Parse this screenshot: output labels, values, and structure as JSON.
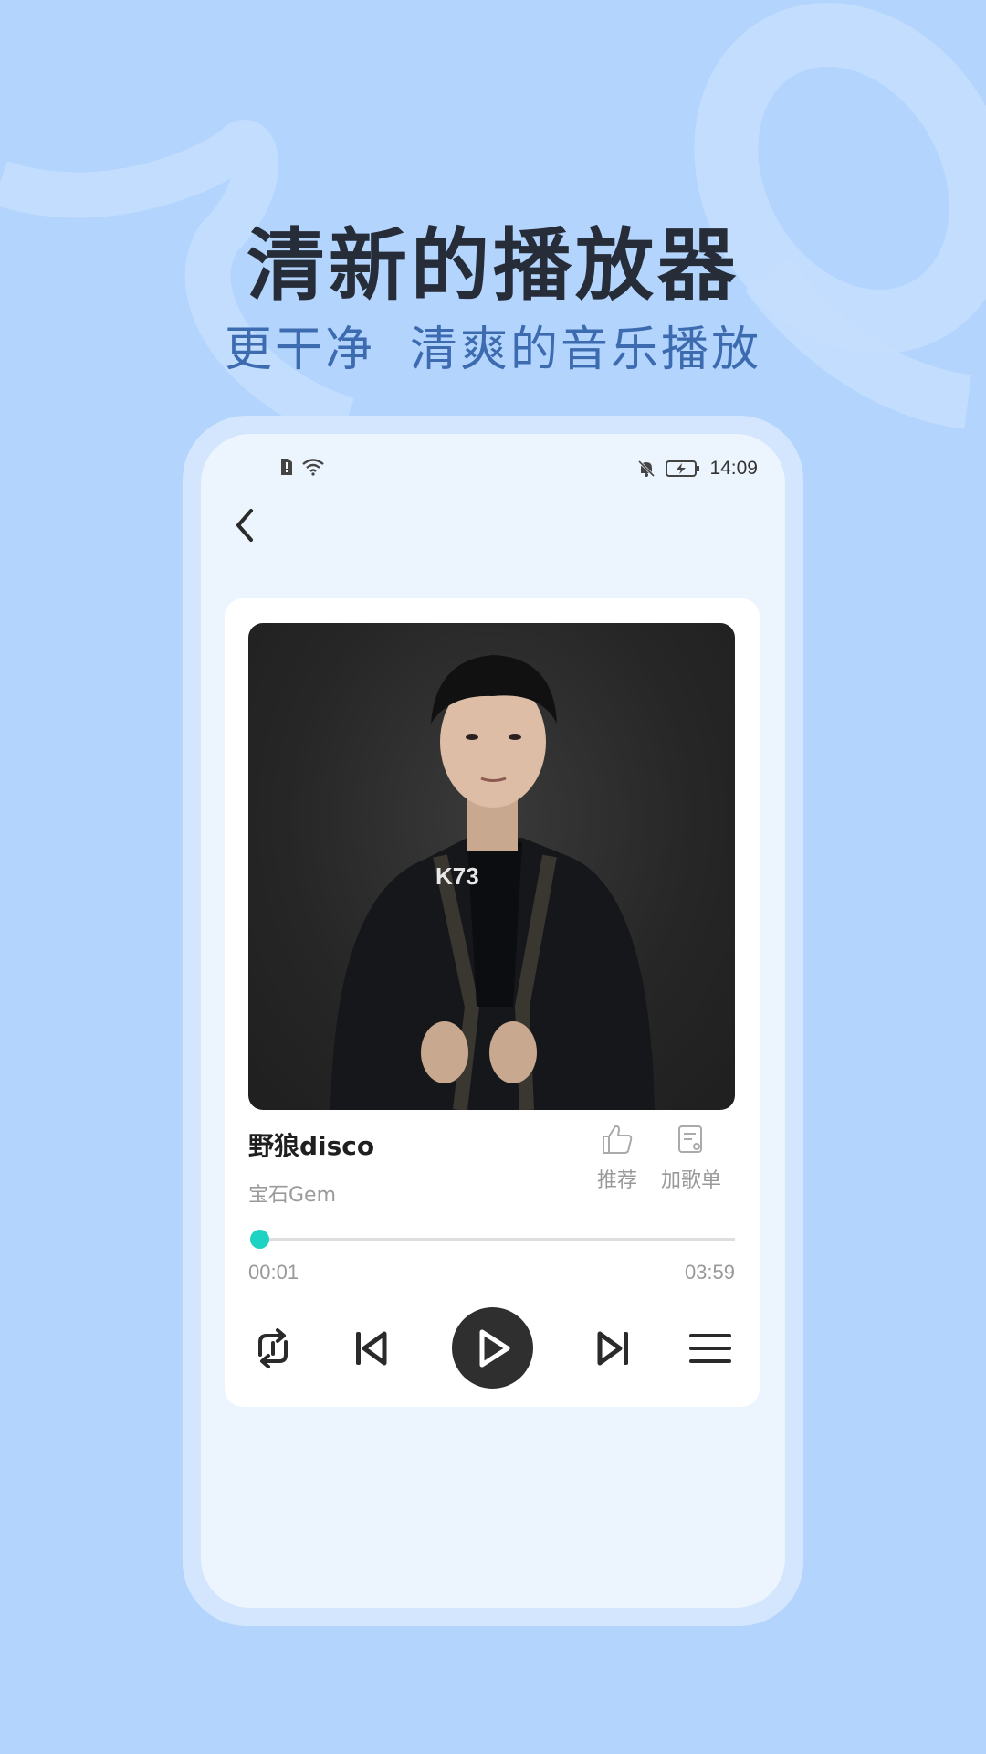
{
  "promo": {
    "headline": "清新的播放器",
    "subhead_part1": "更干净",
    "subhead_part2": "清爽的音乐播放"
  },
  "status_bar": {
    "time": "14:09",
    "icons_left": [
      "sim-alert-icon",
      "wifi-icon"
    ],
    "icons_right": [
      "mute-bell-icon",
      "battery-charging-icon"
    ]
  },
  "player": {
    "song_title": "野狼disco",
    "artist": "宝石Gem",
    "watermark": "K73",
    "actions": {
      "like_label": "推荐",
      "add_playlist_label": "加歌单"
    },
    "progress": {
      "current_time": "00:01",
      "total_time": "03:59",
      "fraction": 0.004
    },
    "controls": [
      "repeat-icon",
      "previous-icon",
      "play-icon",
      "next-icon",
      "playlist-icon"
    ]
  },
  "colors": {
    "background": "#b3d4fd",
    "headline": "#262d38",
    "subhead": "#3d6bb0",
    "accent": "#1ed3c2",
    "play_button": "#2f2f2f"
  }
}
